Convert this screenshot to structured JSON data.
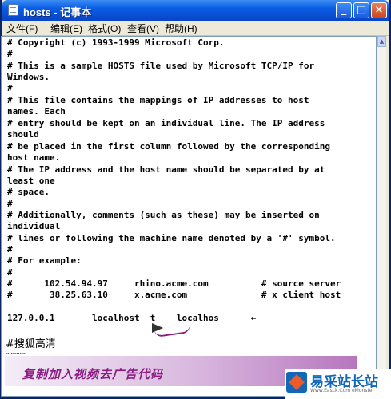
{
  "window": {
    "title": "hosts - 记事本",
    "controls": {
      "minimize": "_",
      "maximize": "□",
      "close": "×"
    }
  },
  "menu": {
    "items": [
      "文件(F)",
      "编辑(E)",
      "格式(O)",
      "查看(V)",
      "帮助(H)"
    ]
  },
  "editor": {
    "lines": [
      "# Copyright (c) 1993-1999 Microsoft Corp.",
      "#",
      "# This is a sample HOSTS file used by Microsoft TCP/IP for",
      "Windows.",
      "#",
      "# This file contains the mappings of IP addresses to host",
      "names. Each",
      "# entry should be kept on an individual line. The IP address",
      "should",
      "# be placed in the first column followed by the corresponding",
      "host name.",
      "# The IP address and the host name should be separated by at",
      "least one",
      "# space.",
      "#",
      "# Additionally, comments (such as these) may be inserted on",
      "individual",
      "# lines or following the machine name denoted by a '#' symbol.",
      "#",
      "# For example:",
      "#",
      "#      102.54.94.97     rhino.acme.com          # source server",
      "#       38.25.63.10     x.acme.com              # x client host",
      "",
      "127.0.0.1       localhost  t    localhos      ←"
    ],
    "sohu_line": "#搜狐高清",
    "dots_line": "…………"
  },
  "annotation": {
    "caption": "复制加入视频去广告代码"
  },
  "watermark": {
    "brand": "易采站长站",
    "sub": "Www.Easck.Com  eMonster"
  },
  "colors": {
    "titlebar": "#0A5DE3",
    "caption": "#8B1C82",
    "logo": "#1268B8"
  }
}
